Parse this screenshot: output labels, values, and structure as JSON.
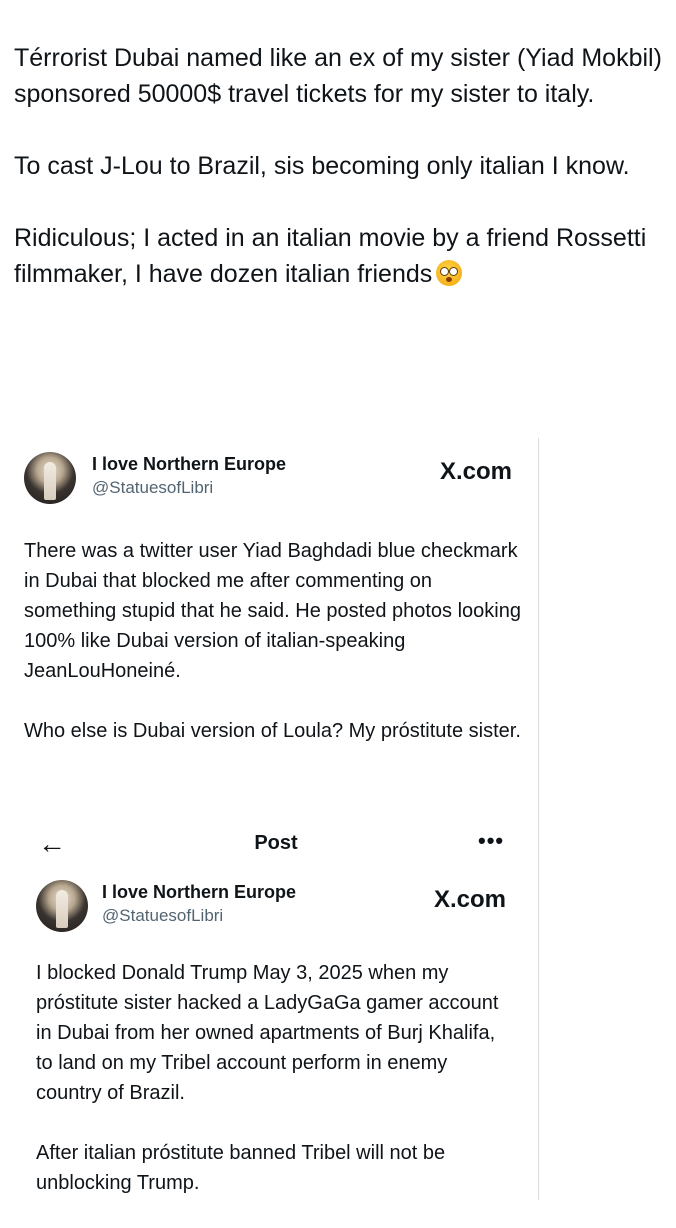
{
  "tweet": {
    "paragraphs": [
      "Térrorist Dubai named like an ex of my sister (Yiad Mokbil) sponsored 50000$ travel tickets for my sister to italy.",
      "To cast J-Lou to Brazil, sis becoming only italian I know.",
      "Ridiculous; I acted in an italian movie by a friend Rossetti filmmaker, I have dozen italian friends"
    ],
    "emoji": "flushed-face-emoji"
  },
  "embed1": {
    "name": "I love Northern Europe",
    "handle": "@StatuesofLibri",
    "source": "X.com",
    "paragraphs": [
      "There was a twitter user Yiad Baghdadi blue checkmark in Dubai that blocked me after commenting on something stupid that he said. He posted photos looking 100% like Dubai version of italian-speaking JeanLouHoneiné.",
      "Who else is Dubai version of Loula? My próstitute sister."
    ]
  },
  "embed2": {
    "header_title": "Post",
    "back_icon": "back-arrow-icon",
    "more_icon": "more-icon",
    "name": "I love Northern Europe",
    "handle": "@StatuesofLibri",
    "source": "X.com",
    "paragraphs": [
      "I blocked Donald Trump May 3, 2025 when my próstitute sister hacked a LadyGaGa gamer account in Dubai from her owned apartments of Burj Khalifa, to land on my Tribel account perform in enemy country of Brazil.",
      "After italian próstitute banned Tribel will not be unblocking Trump."
    ]
  }
}
